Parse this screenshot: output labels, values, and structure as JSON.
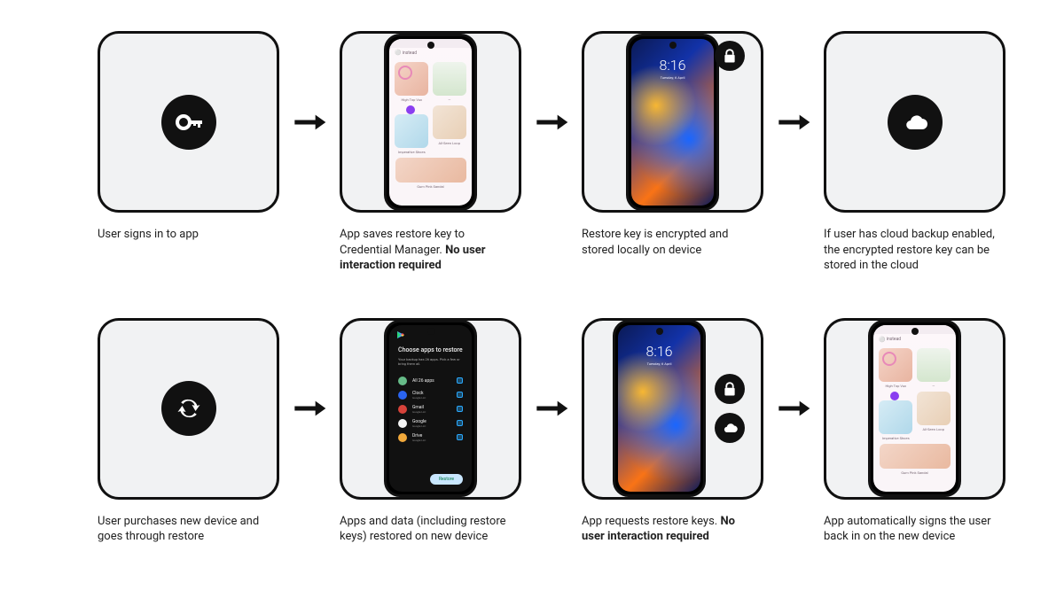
{
  "row1": {
    "step1": {
      "caption": "User signs in to app"
    },
    "step2": {
      "caption_pre": "App saves restore key to Credential Manager. ",
      "caption_bold": "No user interaction required",
      "app_header": "instead"
    },
    "step3": {
      "caption": "Restore key is encrypted and stored locally on device",
      "lock_time": "8:16",
      "lock_date": "Tuesday, 6 April"
    },
    "step4": {
      "caption": "If user has cloud backup enabled, the encrypted restore key can be stored in the cloud"
    }
  },
  "row2": {
    "step1": {
      "caption": "User purchases new device and goes through restore"
    },
    "step2": {
      "caption": "Apps and data (including restore keys) restored on new device",
      "title": "Choose apps to restore",
      "subtitle": "Your backup has 26 apps. Pick a few or bring them all.",
      "all_label": "All 26 apps",
      "items": [
        {
          "name": "Clock",
          "sub": "Google LLC",
          "color": "#2a64f0"
        },
        {
          "name": "Gmail",
          "sub": "Google LLC",
          "color": "#d7423a"
        },
        {
          "name": "Google",
          "sub": "Google LLC",
          "color": "#f5f5f5"
        },
        {
          "name": "Drive",
          "sub": "Google LLC",
          "color": "#f2a93b"
        }
      ],
      "button": "Restore"
    },
    "step3": {
      "caption_pre": "App requests restore keys. ",
      "caption_bold": "No user interaction required",
      "lock_time": "8:16",
      "lock_date": "Tuesday, 6 April"
    },
    "step4": {
      "caption": "App automatically signs the user back in on the new device",
      "app_header": "instead"
    }
  },
  "products": {
    "p1": "High Top Vux",
    "p2": "—",
    "p3": "Imperative Shoes",
    "p4": "All-Seen Loop",
    "p5": "Gum Pink Sandal"
  }
}
